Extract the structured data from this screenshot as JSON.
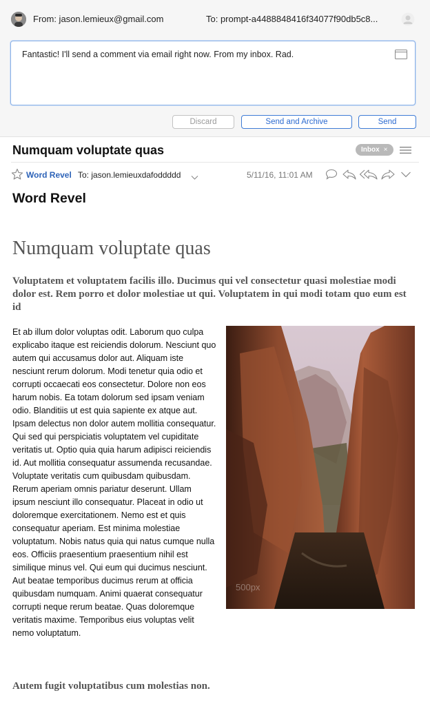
{
  "compose": {
    "from": "From: jason.lemieux@gmail.com",
    "to": "To: prompt-a4488848416f34077f90db5c8...",
    "message": "Fantastic! I'll send a comment via email right now. From my inbox. Rad.",
    "buttons": {
      "discard": "Discard",
      "send_archive": "Send and Archive",
      "send": "Send"
    }
  },
  "message": {
    "subject": "Numquam voluptate quas",
    "tag": "Inbox",
    "sender_name": "Word Revel",
    "recipient": "To: jason.lemieuxdafoddddd",
    "date": "5/11/16, 11:01 AM",
    "icons": [
      "star-icon",
      "chevron-down-icon",
      "comment-icon",
      "reply-icon",
      "reply-all-icon",
      "forward-icon",
      "more-chevron-icon"
    ]
  },
  "article": {
    "from_title": "Word Revel",
    "headline": "Numquam voluptate quas",
    "lead": "Voluptatem et voluptatem facilis illo. Ducimus qui vel consectetur quasi molestiae modi dolor est. Rem porro et dolor molestiae ut qui. Voluptatem in qui modi totam quo eum est id",
    "body": "Et ab illum dolor voluptas odit. Laborum quo culpa explicabo itaque est reiciendis dolorum. Nesciunt quo autem qui accusamus dolor aut. Aliquam iste nesciunt rerum dolorum. Modi tenetur quia odio et corrupti occaecati eos consectetur. Dolore non eos harum nobis. Ea totam dolorum sed ipsam veniam odio. Blanditiis ut est quia sapiente ex atque aut. Ipsam delectus non dolor autem mollitia consequatur. Qui sed qui perspiciatis voluptatem vel cupiditate veritatis ut. Optio quia quia harum adipisci reiciendis id. Aut mollitia consequatur assumenda recusandae. Voluptate veritatis cum quibusdam quibusdam. Rerum aperiam omnis pariatur deserunt. Ullam ipsum nesciunt illo consequatur. Placeat in odio ut doloremque exercitationem. Nemo est et quis consequatur aperiam. Est minima molestiae voluptatum. Nobis natus quia qui natus cumque nulla eos. Officiis praesentium praesentium nihil est similique minus vel. Qui eum qui ducimus nesciunt. Aut beatae temporibus ducimus rerum at officia quibusdam numquam. Animi quaerat consequatur corrupti neque rerum beatae. Quas doloremque veritatis maxime. Temporibus eius voluptas velit nemo voluptatum.",
    "photo_watermark": "500px",
    "closing": "Autem fugit voluptatibus cum molestias non."
  }
}
